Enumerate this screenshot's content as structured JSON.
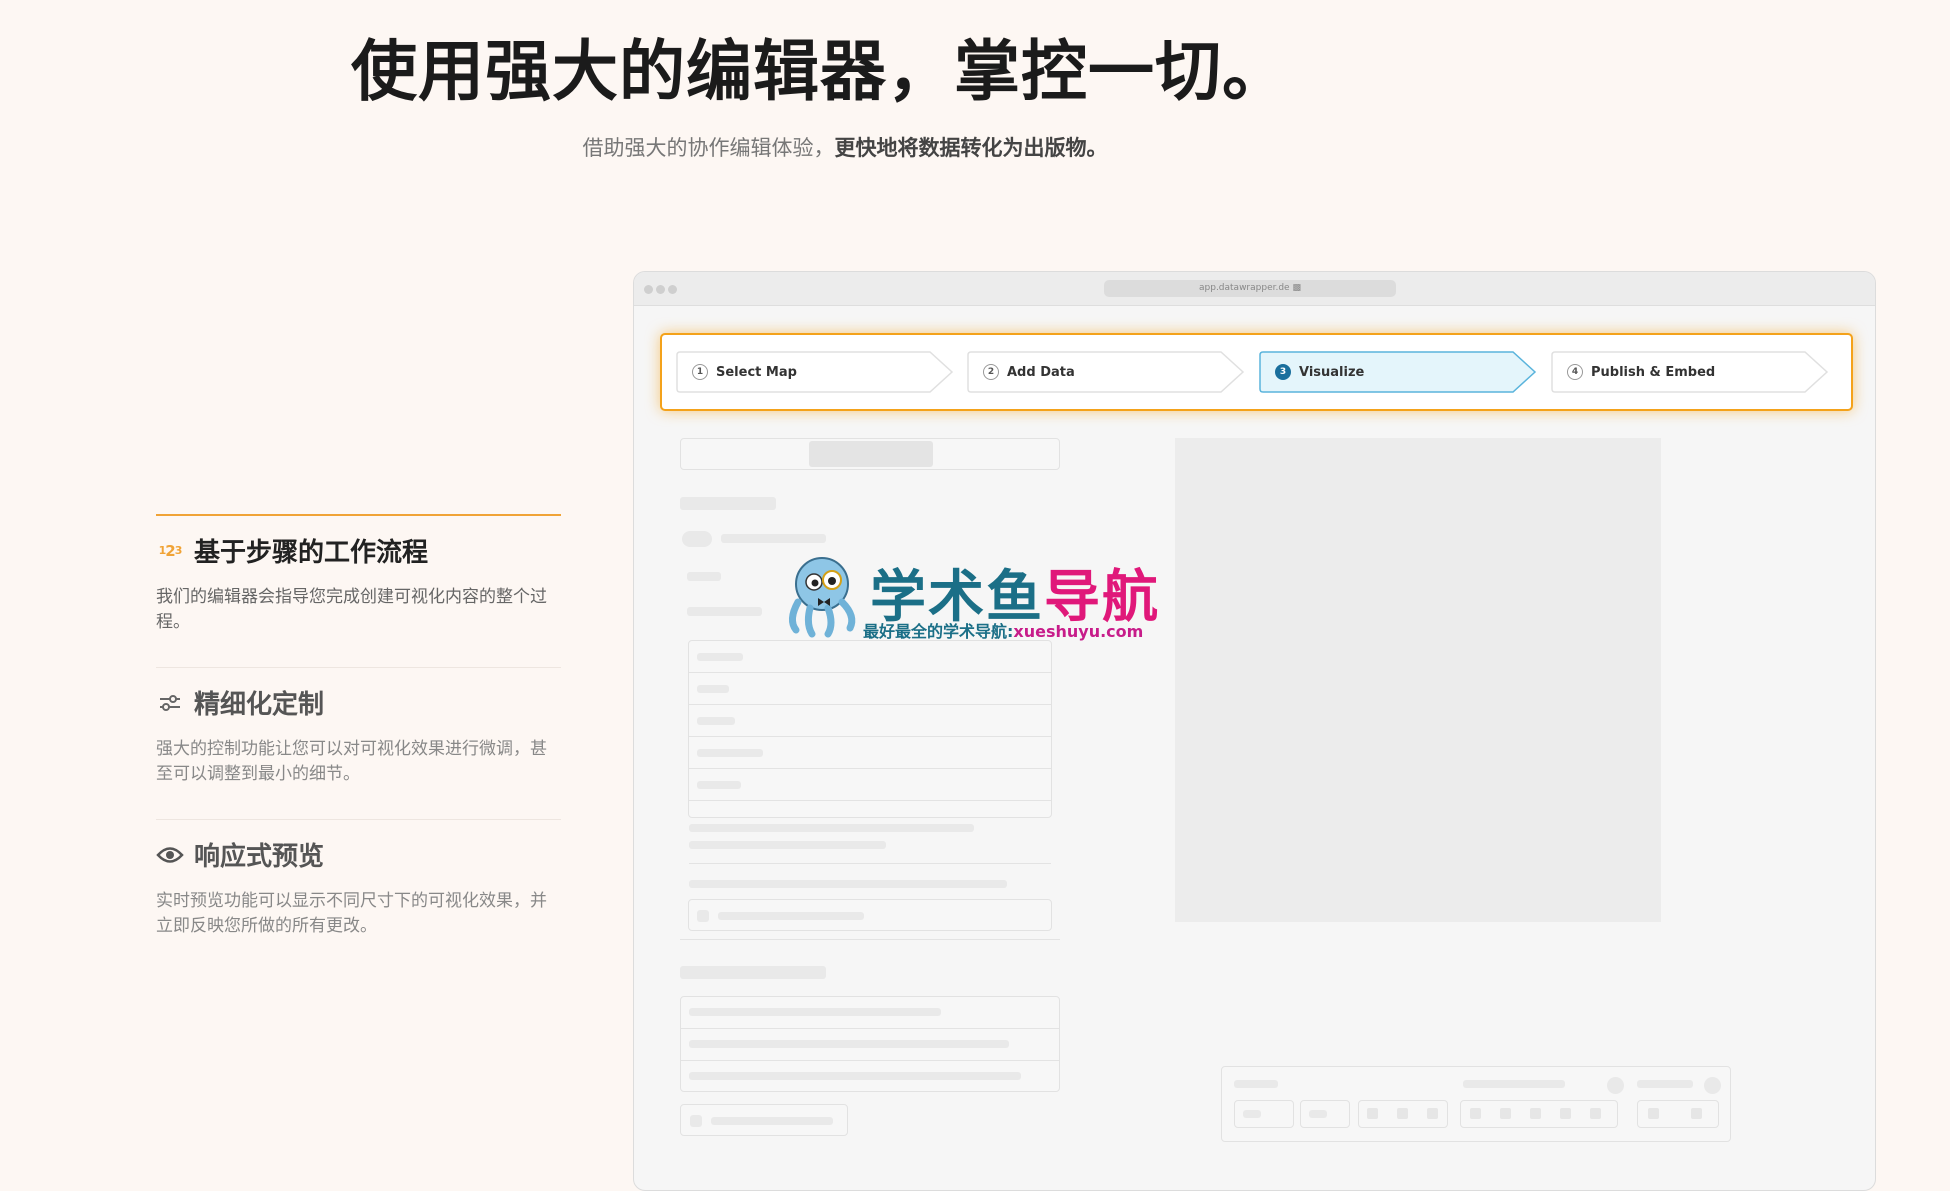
{
  "hero": {
    "title": "使用强大的编辑器，掌控一切。",
    "subtitle_plain": "借助强大的协作编辑体验，",
    "subtitle_bold": "更快地将数据转化为出版物。"
  },
  "features": [
    {
      "title": "基于步骤的工作流程",
      "icon": "steps-123-icon",
      "description": "我们的编辑器会指导您完成创建可视化内容的整个过程。"
    },
    {
      "title": "精细化定制",
      "icon": "sliders-icon",
      "description": "强大的控制功能让您可以对可视化效果进行微调，甚至可以调整到最小的细节。"
    },
    {
      "title": "响应式预览",
      "icon": "eye-icon",
      "description": "实时预览功能可以显示不同尺寸下的可视化效果，并立即反映您所做的所有更改。"
    }
  ],
  "steps_icon_text": {
    "a": "1",
    "b": "2",
    "c": "3"
  },
  "browser": {
    "url": "app.datawrapper.de",
    "steps": [
      {
        "num": "1",
        "label": "Select Map"
      },
      {
        "num": "2",
        "label": "Add Data"
      },
      {
        "num": "3",
        "label": "Visualize"
      },
      {
        "num": "4",
        "label": "Publish & Embed"
      }
    ],
    "active_step": 3
  },
  "watermark": {
    "title_a": "学术鱼",
    "title_b": "导航",
    "sub_a": "最好最全的学术导航:",
    "sub_b": "xueshuyu.com"
  },
  "colors": {
    "background": "#fdf7f3",
    "accent_orange": "#f0a336",
    "active_step_fill": "#e4f5fb",
    "active_step_stroke": "#5ab4dc",
    "step_badge_blue": "#1a6f9d"
  }
}
